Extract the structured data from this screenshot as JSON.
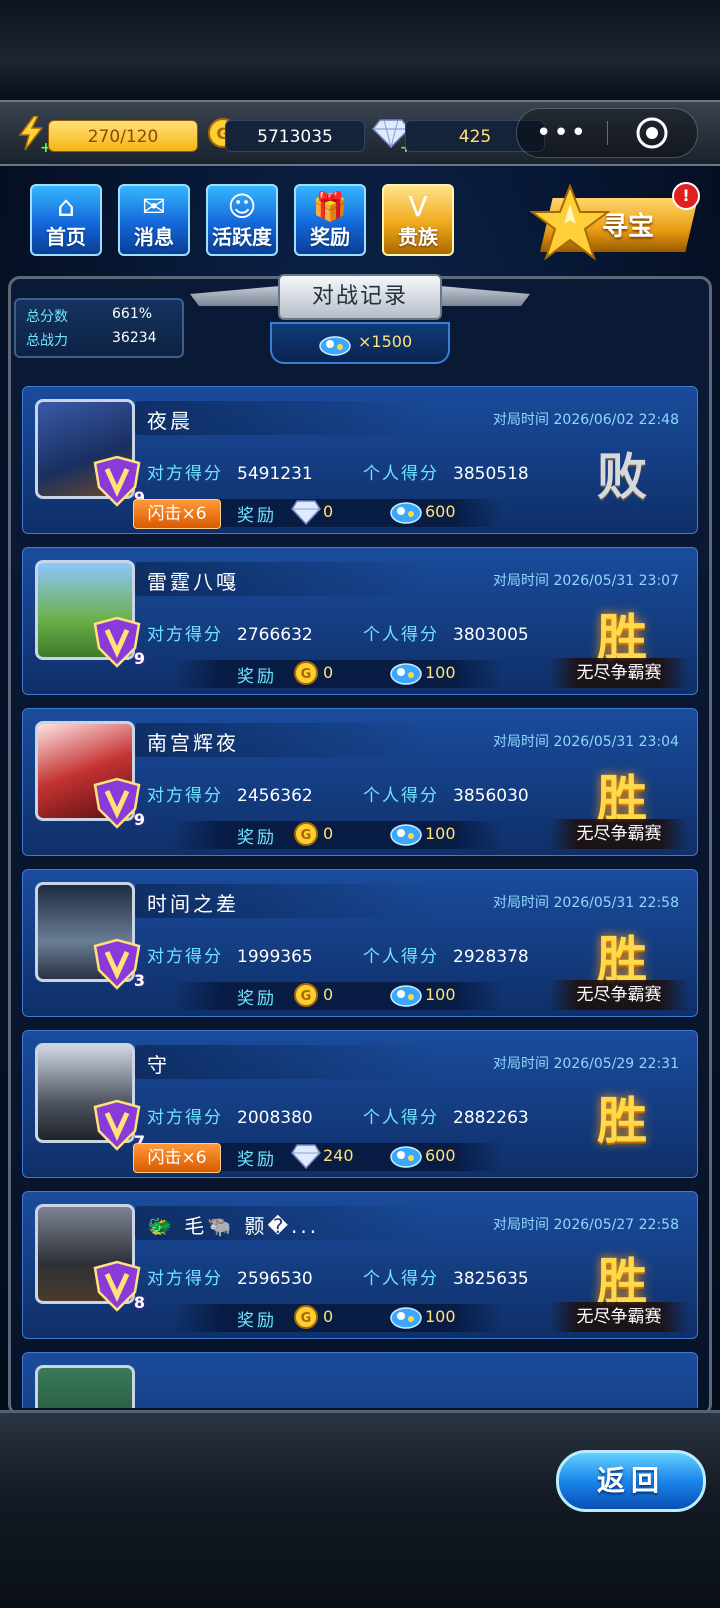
{
  "status": {
    "energy": "270/120",
    "gold": "5713035",
    "gems": "425"
  },
  "capsule": {
    "more": "•••",
    "close_icon": "target-circle-icon"
  },
  "nav": {
    "home": "首页",
    "messages": "消息",
    "activity": "活跃度",
    "rewards": "奖励",
    "noble": "贵族",
    "treasure": "寻宝",
    "treasure_badge": "!"
  },
  "panel": {
    "title": "对战记录",
    "total_score_label": "总分数",
    "total_score_value": "661%",
    "total_power_label": "总战力",
    "total_power_value": "36234",
    "ticket_text": "×1500"
  },
  "labels": {
    "time": "对局时间",
    "opponent_score": "对方得分",
    "personal_score": "个人得分",
    "reward": "奖励"
  },
  "records": [
    {
      "name": "夜晨",
      "time": "2026/06/02 22:48",
      "opp": "5491231",
      "mine": "3850518",
      "result": "败",
      "win": false,
      "mode": "",
      "flash": "闪击×6",
      "reward1_type": "gem",
      "reward1": "0",
      "reward2": "600",
      "vip": "9"
    },
    {
      "name": "雷霆八嘎",
      "time": "2026/05/31 23:07",
      "opp": "2766632",
      "mine": "3803005",
      "result": "胜",
      "win": true,
      "mode": "无尽争霸赛",
      "flash": "",
      "reward1_type": "coin",
      "reward1": "0",
      "reward2": "100",
      "vip": "9"
    },
    {
      "name": "南宫辉夜",
      "time": "2026/05/31 23:04",
      "opp": "2456362",
      "mine": "3856030",
      "result": "胜",
      "win": true,
      "mode": "无尽争霸赛",
      "flash": "",
      "reward1_type": "coin",
      "reward1": "0",
      "reward2": "100",
      "vip": "9"
    },
    {
      "name": "时间之差",
      "time": "2026/05/31 22:58",
      "opp": "1999365",
      "mine": "2928378",
      "result": "胜",
      "win": true,
      "mode": "无尽争霸赛",
      "flash": "",
      "reward1_type": "coin",
      "reward1": "0",
      "reward2": "100",
      "vip": "3"
    },
    {
      "name": "守",
      "time": "2026/05/29 22:31",
      "opp": "2008380",
      "mine": "2882263",
      "result": "胜",
      "win": true,
      "mode": "",
      "flash": "闪击×6",
      "reward1_type": "gem",
      "reward1": "240",
      "reward2": "600",
      "vip": "7"
    },
    {
      "name": "🐲 毛🐃 颢�...",
      "time": "2026/05/27 22:58",
      "opp": "2596530",
      "mine": "3825635",
      "result": "胜",
      "win": true,
      "mode": "无尽争霸赛",
      "flash": "",
      "reward1_type": "coin",
      "reward1": "0",
      "reward2": "100",
      "vip": "8"
    }
  ],
  "back_button": "返回",
  "colors": {
    "accent_gold": "#ffd94a",
    "accent_blue": "#1b86ea",
    "card_blue": "#1a4c9c"
  }
}
